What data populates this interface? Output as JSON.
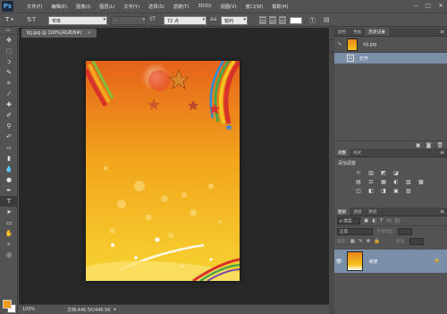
{
  "app": {
    "logo": "Ps"
  },
  "menus": [
    "文件(F)",
    "编辑(E)",
    "图像(I)",
    "图层(L)",
    "文字(Y)",
    "选择(S)",
    "滤镜(T)",
    "3D(D)",
    "视图(V)",
    "窗口(W)",
    "帮助(H)"
  ],
  "window_controls": {
    "minimize": "—",
    "maximize": "□",
    "close": "✕"
  },
  "options": {
    "tool_glyph": "T",
    "font_family": "宋体",
    "font_style": "-",
    "font_size": "72 点",
    "antialias": "锐利",
    "size_icon": "tT",
    "aa_icon": "aa"
  },
  "document": {
    "tab_label": "bjj.jpg @ 100%(RGB/8#)",
    "tab_close": "×",
    "zoom": "100%",
    "doc_info": "文档:446.5K/446.5K",
    "canvas_colors": {
      "top": "#e5621a",
      "mid": "#f2a51c",
      "bottom": "#f7d431"
    }
  },
  "panels": {
    "top_tabs": [
      "颜色",
      "色板",
      "历史记录"
    ],
    "history": {
      "snapshot_name": "bjj.jpg",
      "rows": [
        {
          "label": "打开"
        }
      ]
    },
    "mid_tabs": [
      "调整",
      "样式"
    ],
    "adjust_title": "添加调整",
    "adjust_row1": [
      "☼",
      "▥",
      "◩",
      "◪"
    ],
    "adjust_row2": [
      "▤",
      "⚖",
      "▦",
      "◐",
      "▧",
      "▩"
    ],
    "adjust_row3": [
      "◫",
      "◧",
      "◨",
      "▣",
      "▨"
    ],
    "layers_tabs": [
      "图层",
      "通道",
      "路径"
    ],
    "layers": {
      "filter_kind": "ρ 类型",
      "blend_mode": "正常",
      "opacity_label": "不透明度:",
      "lock_label": "锁定:",
      "fill_label": "填充:",
      "items": [
        {
          "name": "背景"
        }
      ]
    }
  },
  "accent": {
    "selection": "#7b8fa8",
    "foreground_color": "#f09a1c",
    "background_color": "#ffffff"
  }
}
